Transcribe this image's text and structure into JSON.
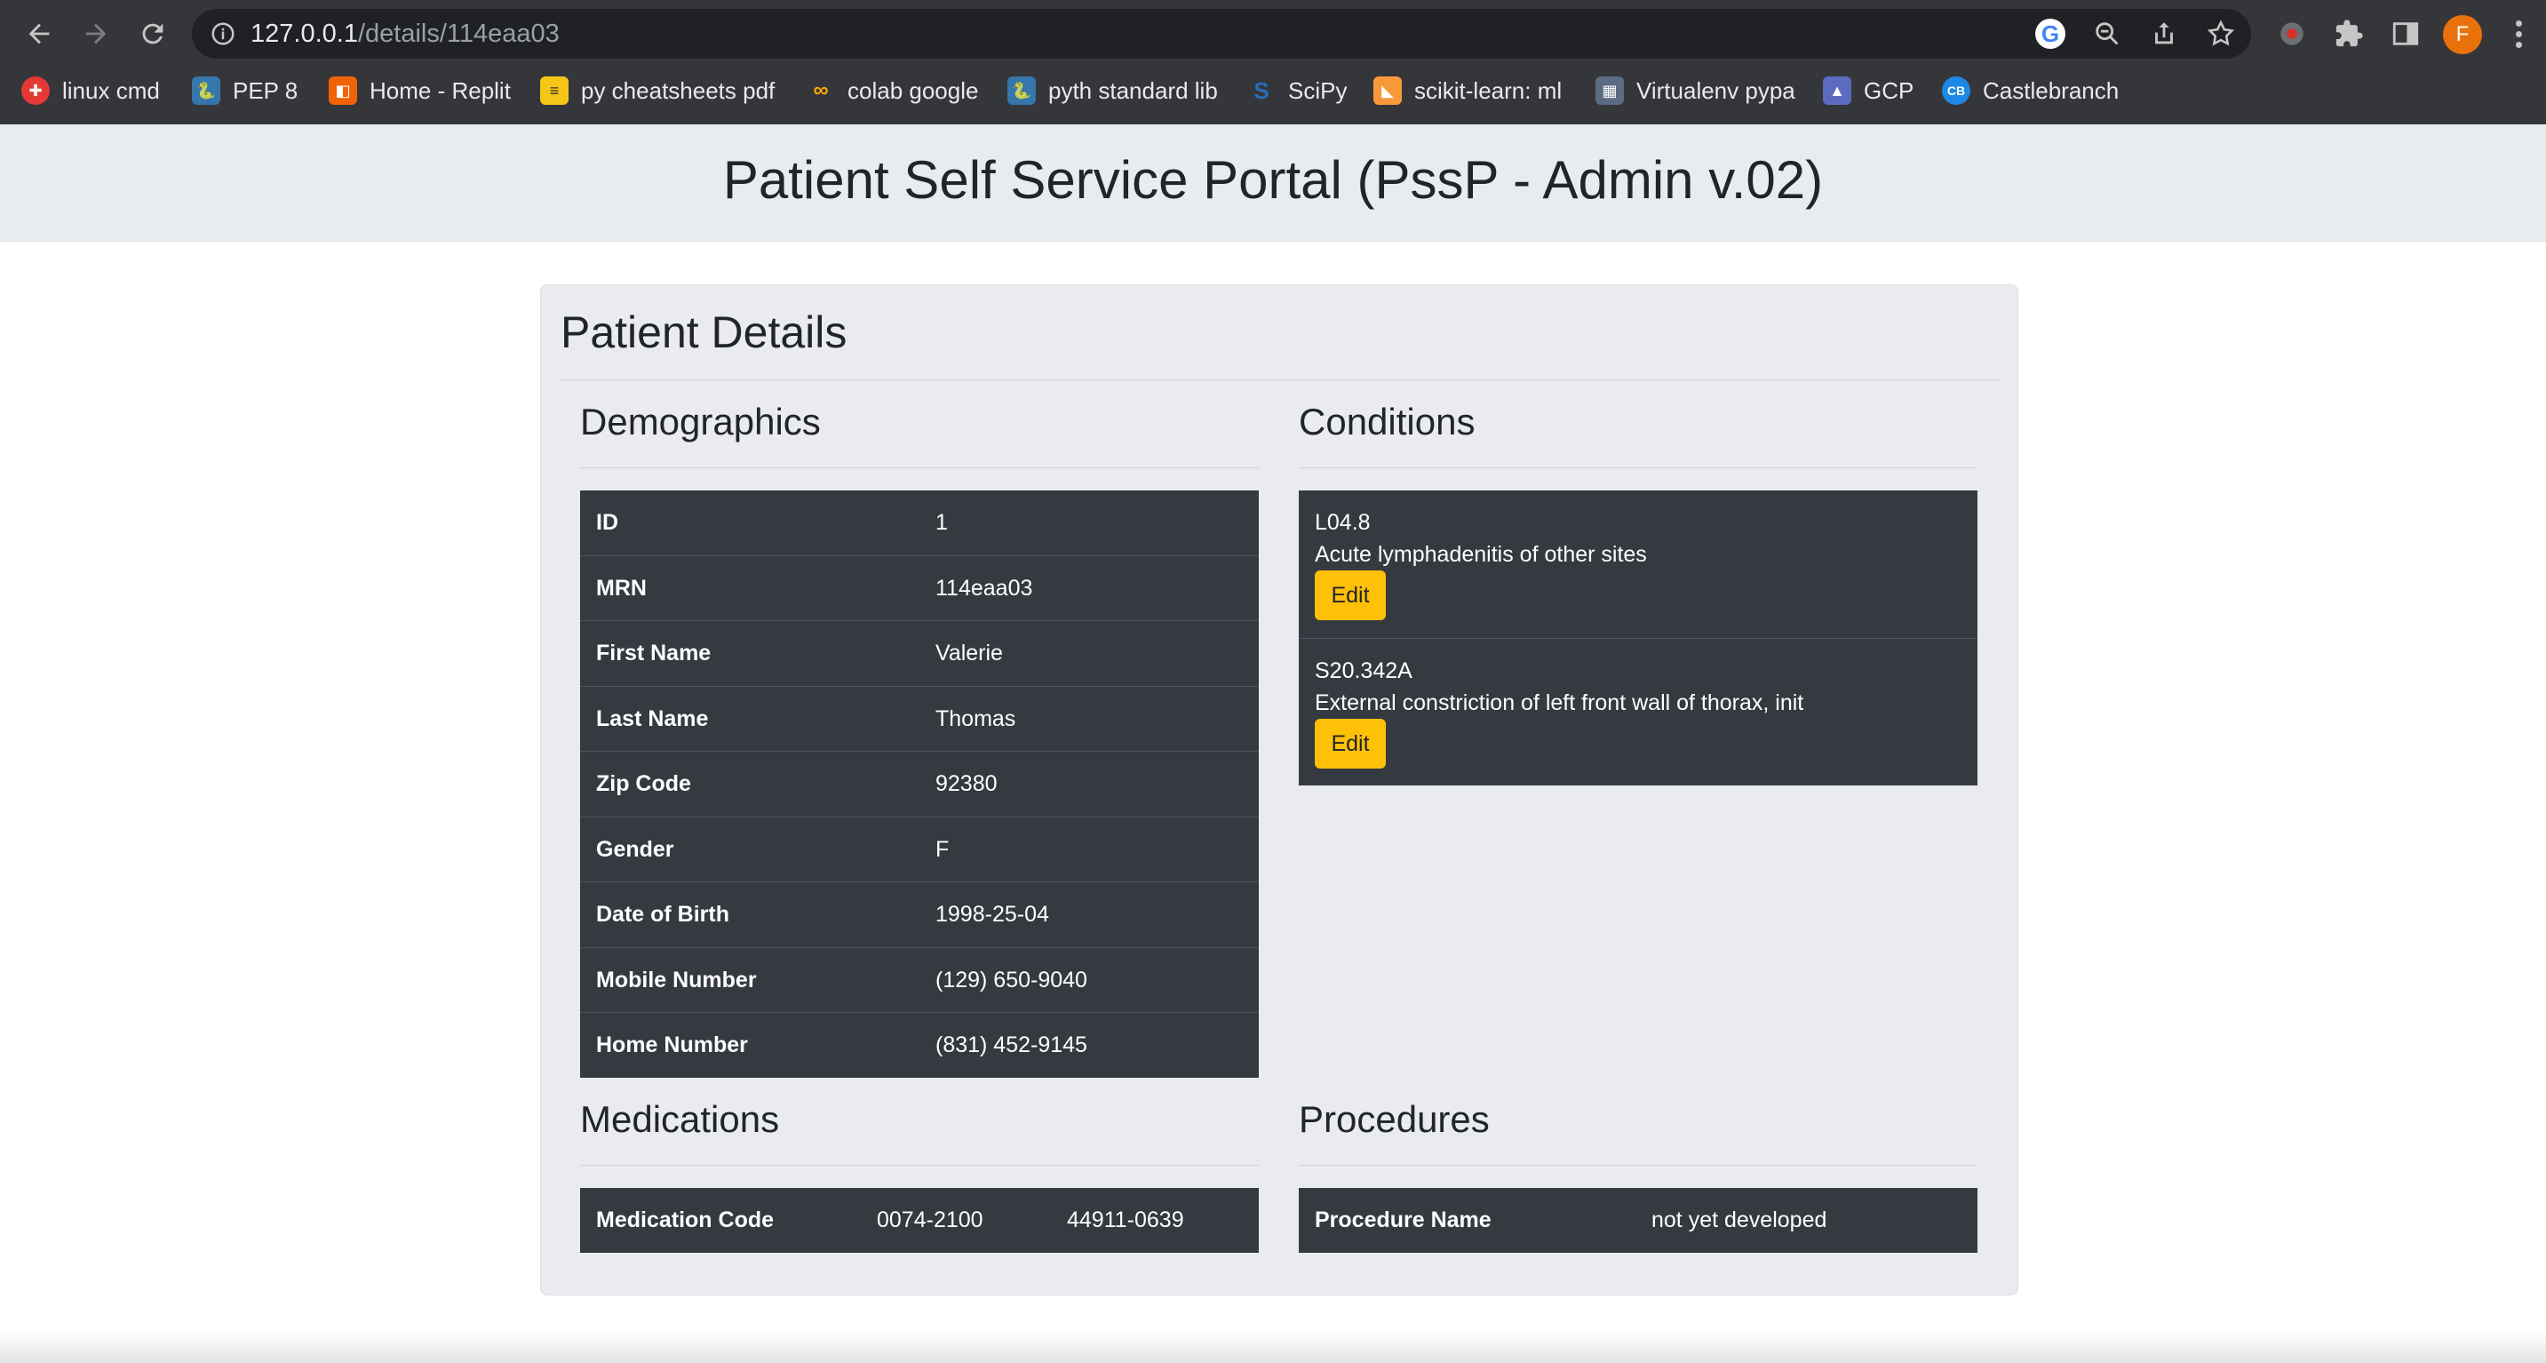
{
  "browser": {
    "url_host": "127.0.0.1",
    "url_path": "/details/114eaa03",
    "profile_initial": "F",
    "bookmarks": [
      {
        "label": "linux cmd",
        "icon": "red-badge-icon",
        "color": "#e53935"
      },
      {
        "label": "PEP 8",
        "icon": "python-icon",
        "color": "#3776ab"
      },
      {
        "label": "Home - Replit",
        "icon": "replit-icon",
        "color": "#f26207"
      },
      {
        "label": "py cheatsheets pdf",
        "icon": "cheatsheet-icon",
        "color": "#f5c518"
      },
      {
        "label": "colab google",
        "icon": "colab-icon",
        "color": "#f9ab00"
      },
      {
        "label": "pyth standard lib",
        "icon": "python-icon",
        "color": "#3776ab"
      },
      {
        "label": "SciPy",
        "icon": "scipy-icon",
        "color": "#2a6ebb"
      },
      {
        "label": "scikit-learn: ml",
        "icon": "sklearn-icon",
        "color": "#f89939"
      },
      {
        "label": "Virtualenv pypa",
        "icon": "virtualenv-icon",
        "color": "#5b6b82"
      },
      {
        "label": "GCP",
        "icon": "gcp-icon",
        "color": "#5c6bc0"
      },
      {
        "label": "Castlebranch",
        "icon": "castlebranch-icon",
        "color": "#1e88e5",
        "icon_text": "CB"
      }
    ]
  },
  "page": {
    "title": "Patient Self Service Portal (PssP - Admin v.02)",
    "card_title": "Patient Details"
  },
  "demographics": {
    "title": "Demographics",
    "rows": [
      {
        "label": "ID",
        "value": "1"
      },
      {
        "label": "MRN",
        "value": "114eaa03"
      },
      {
        "label": "First Name",
        "value": "Valerie"
      },
      {
        "label": "Last Name",
        "value": "Thomas"
      },
      {
        "label": "Zip Code",
        "value": "92380"
      },
      {
        "label": "Gender",
        "value": "F"
      },
      {
        "label": "Date of Birth",
        "value": "1998-25-04"
      },
      {
        "label": "Mobile Number",
        "value": "(129) 650-9040"
      },
      {
        "label": "Home Number",
        "value": "(831) 452-9145"
      }
    ]
  },
  "conditions": {
    "title": "Conditions",
    "edit_label": "Edit",
    "items": [
      {
        "code": "L04.8",
        "description": "Acute lymphadenitis of other sites"
      },
      {
        "code": "S20.342A",
        "description": "External constriction of left front wall of thorax, init"
      }
    ]
  },
  "medications": {
    "title": "Medications",
    "label": "Medication Code",
    "codes": [
      "0074-2100",
      "44911-0639"
    ]
  },
  "procedures": {
    "title": "Procedures",
    "label": "Procedure Name",
    "value": "not yet developed"
  },
  "colors": {
    "chrome_bg": "#35363a",
    "header_bg": "#e9ecef",
    "table_bg": "#343a40",
    "edit_button": "#ffc107",
    "avatar": "#e8710a"
  }
}
